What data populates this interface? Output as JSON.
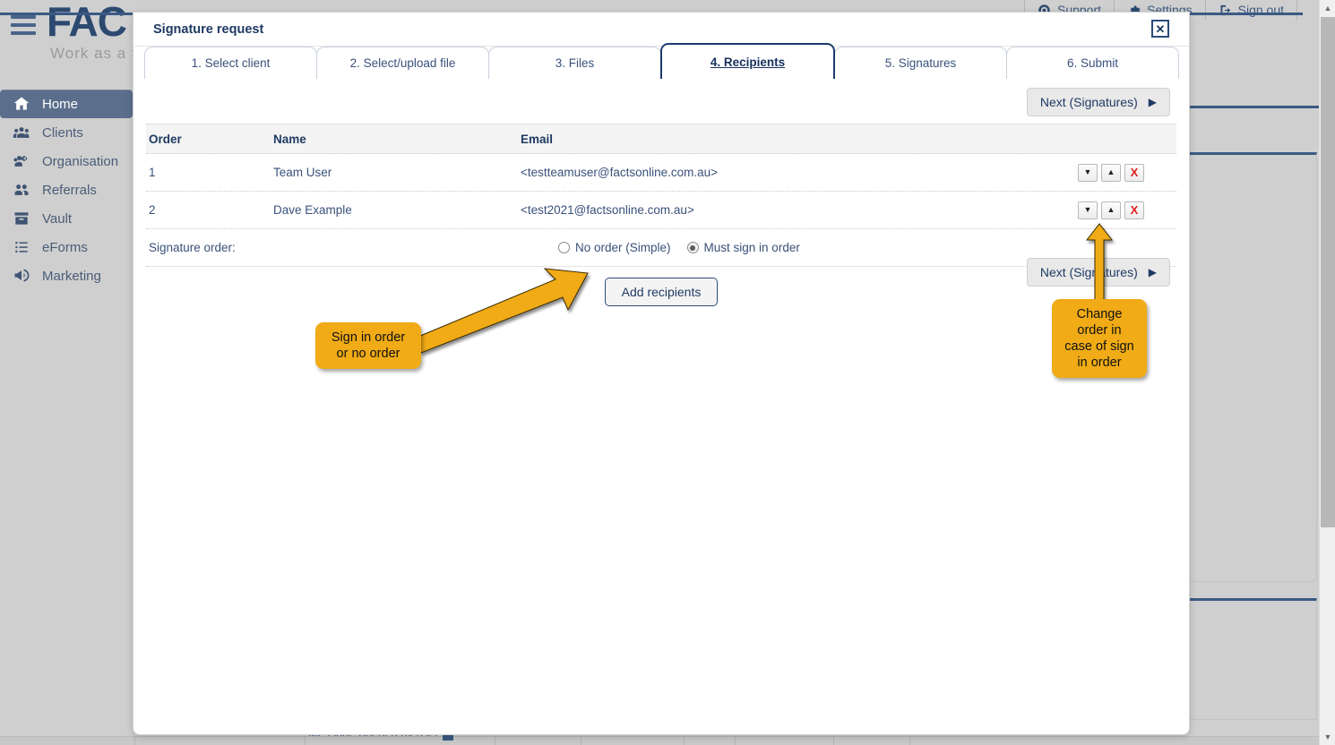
{
  "app": {
    "logo_text": "FAC",
    "tagline": "Work as a te",
    "hamburger_icon": "hamburger-menu-icon",
    "header_links": [
      {
        "label": "Support",
        "icon": "lifebuoy-icon"
      },
      {
        "label": "Settings",
        "icon": "gear-icon"
      },
      {
        "label": "Sign out",
        "icon": "sign-out-icon"
      }
    ],
    "background_text": "Message opened by user"
  },
  "sidebar": {
    "items": [
      {
        "label": "Home",
        "icon": "home-icon",
        "active": true
      },
      {
        "label": "Clients",
        "icon": "clients-group-icon",
        "active": false
      },
      {
        "label": "Organisation",
        "icon": "organisation-gear-icon",
        "active": false
      },
      {
        "label": "Referrals",
        "icon": "referrals-people-icon",
        "active": false
      },
      {
        "label": "Vault",
        "icon": "vault-box-icon",
        "active": false
      },
      {
        "label": "eForms",
        "icon": "list-icon",
        "active": false
      },
      {
        "label": "Marketing",
        "icon": "megaphone-icon",
        "active": false
      }
    ]
  },
  "dialog": {
    "title": "Signature request",
    "close_label": "✕",
    "close_icon": "close-icon",
    "tabs": [
      {
        "label": "1. Select client",
        "active": false
      },
      {
        "label": "2. Select/upload file",
        "active": false
      },
      {
        "label": "3. Files",
        "active": false
      },
      {
        "label": "4. Recipients",
        "active": true
      },
      {
        "label": "5. Signatures",
        "active": false
      },
      {
        "label": "6. Submit",
        "active": false
      }
    ],
    "next_button": {
      "label": "Next (Signatures)",
      "caret": "▶"
    },
    "table": {
      "columns": [
        "Order",
        "Name",
        "Email"
      ],
      "rows": [
        {
          "order": "1",
          "name": "Team User",
          "email": "<testteamuser@factsonline.com.au>",
          "actions": [
            {
              "glyph": "▼",
              "name": "move-down-button"
            },
            {
              "glyph": "▲",
              "name": "move-up-button"
            },
            {
              "glyph": "X",
              "name": "delete-recipient-button"
            }
          ]
        },
        {
          "order": "2",
          "name": "Dave Example",
          "email": "<test2021@factsonline.com.au>",
          "actions": [
            {
              "glyph": "▼",
              "name": "move-down-button"
            },
            {
              "glyph": "▲",
              "name": "move-up-button"
            },
            {
              "glyph": "X",
              "name": "delete-recipient-button"
            }
          ]
        }
      ]
    },
    "signature_order": {
      "label": "Signature order:",
      "options": [
        {
          "label": "No order (Simple)",
          "selected": false
        },
        {
          "label": "Must sign in order",
          "selected": true
        }
      ]
    },
    "add_recipients_button": "Add recipients"
  },
  "annotations": [
    {
      "id": "sign-order",
      "text": "Sign in order\nor no order",
      "line1": "Sign in order",
      "line2": "or no order"
    },
    {
      "id": "change-order",
      "text": "Change order in case of sign in order",
      "line1": "Change",
      "line2": "order in",
      "line3": "case of sign",
      "line4": "in order"
    }
  ],
  "colors": {
    "brand_navy": "#2c4a70",
    "accent_yellow": "#f0ab16",
    "delete_red": "#e02020",
    "sidebar_bg": "#cfcfcf",
    "active_nav": "#5b6e8c"
  }
}
